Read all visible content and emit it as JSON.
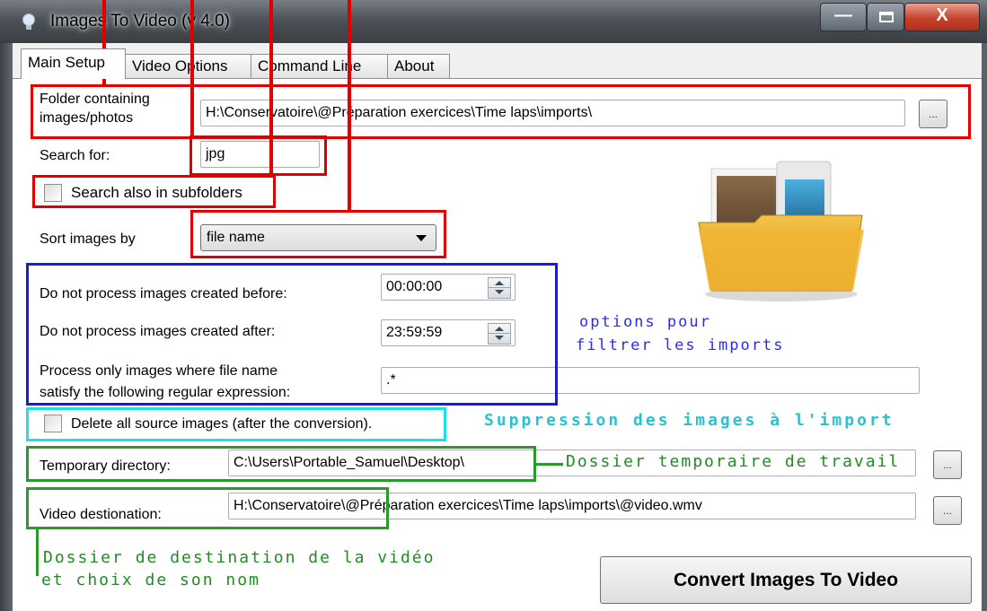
{
  "window": {
    "title": "Images To Video (v 4.0)",
    "minimize_glyph": "—",
    "close_glyph": "X"
  },
  "tabs": [
    {
      "label": "Main Setup",
      "active": true
    },
    {
      "label": "Video Options",
      "active": false
    },
    {
      "label": "Command Line",
      "active": false
    },
    {
      "label": "About",
      "active": false
    }
  ],
  "main_setup": {
    "folder_label_line1": "Folder containing",
    "folder_label_line2": "images/photos",
    "folder_value": "H:\\Conservatoire\\@Préparation exercices\\Time laps\\imports\\",
    "browse_label": "...",
    "search_label": "Search for:",
    "search_value": "jpg",
    "subfolders_label": "Search also in subfolders",
    "subfolders_checked": false,
    "sort_label": "Sort images by",
    "sort_value": "file name",
    "before_label": "Do not process images created before:",
    "before_value": "00:00:00",
    "after_label": "Do not process images created after:",
    "after_value": "23:59:59",
    "regex_label_line1": "Process only images where file name",
    "regex_label_line2": "satisfy the following regular expression:",
    "regex_value": ".*",
    "delete_label": "Delete all source images (after the conversion).",
    "delete_checked": false,
    "temp_label": "Temporary directory:",
    "temp_value": "C:\\Users\\Portable_Samuel\\Desktop\\",
    "dest_label": "Video destionation:",
    "dest_value": "H:\\Conservatoire\\@Préparation exercices\\Time laps\\imports\\@video.wmv",
    "convert_label": "Convert Images To Video"
  },
  "annotations": {
    "filter_line1": "options pour",
    "filter_line2": "filtrer les imports",
    "delete_note": "Suppression des images à l'import",
    "temp_note": "Dossier temporaire de travail",
    "dest_note_line1": "Dossier de destination de la vidéo",
    "dest_note_line2": "et choix de son nom"
  },
  "colors": {
    "annotation_red": "#e00000",
    "annotation_blue": "#1b1bd6",
    "annotation_cyan": "#1fe0e8",
    "annotation_green": "#2b9a2b"
  }
}
